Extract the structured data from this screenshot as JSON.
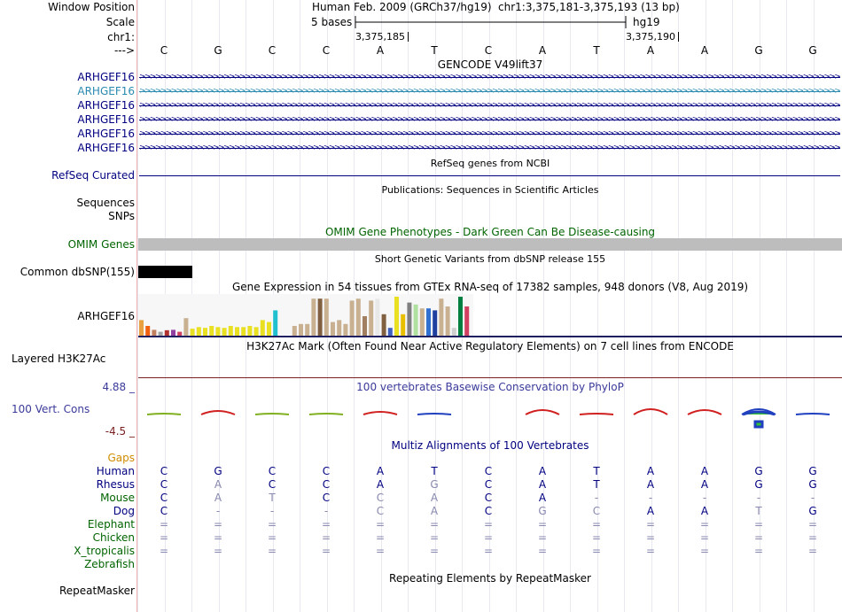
{
  "header": {
    "window_position_label": "Window Position",
    "scale_label": "Scale",
    "chr_label": "chr1:",
    "strand_label": "--->",
    "assembly": "Human Feb. 2009 (GRCh37/hg19)",
    "position": "chr1:3,375,181-3,375,193 (13 bp)",
    "scale_text": "5 bases",
    "db": "hg19",
    "coord1": "3,375,185",
    "coord2": "3,375,190"
  },
  "sequence": [
    "C",
    "G",
    "C",
    "C",
    "A",
    "T",
    "C",
    "A",
    "T",
    "A",
    "A",
    "G",
    "G"
  ],
  "gencode": {
    "title": "GENCODE V49lift37",
    "genes": [
      {
        "label": "ARHGEF16",
        "color": "#000080"
      },
      {
        "label": "ARHGEF16",
        "color": "#2a8ab0"
      },
      {
        "label": "ARHGEF16",
        "color": "#000080"
      },
      {
        "label": "ARHGEF16",
        "color": "#000080"
      },
      {
        "label": "ARHGEF16",
        "color": "#000080"
      },
      {
        "label": "ARHGEF16",
        "color": "#000080"
      }
    ]
  },
  "refseq": {
    "title": "RefSeq genes from NCBI",
    "label": "RefSeq Curated"
  },
  "publications": {
    "title": "Publications: Sequences in Scientific Articles",
    "label1": "Sequences",
    "label2": "SNPs"
  },
  "omim": {
    "title": "OMIM Gene Phenotypes - Dark Green Can Be Disease-causing",
    "label": "OMIM Genes"
  },
  "dbsnp": {
    "title": "Short Genetic Variants from dbSNP release 155",
    "label": "Common dbSNP(155)"
  },
  "gtex": {
    "title": "Gene Expression in 54 tissues from GTEx RNA-seq of 17382 samples, 948 donors (V8, Aug 2019)",
    "label": "ARHGEF16",
    "bars": [
      {
        "v": 0.4,
        "c": "#e8a040"
      },
      {
        "v": 0.25,
        "c": "#f06010"
      },
      {
        "v": 0.15,
        "c": "#c08060"
      },
      {
        "v": 0.1,
        "c": "#a0a0a0"
      },
      {
        "v": 0.14,
        "c": "#b03030"
      },
      {
        "v": 0.15,
        "c": "#9040a0"
      },
      {
        "v": 0.1,
        "c": "#d04060"
      },
      {
        "v": 0.45,
        "c": "#c8b090"
      },
      {
        "v": 0.18,
        "c": "#e8e020"
      },
      {
        "v": 0.22,
        "c": "#e8e020"
      },
      {
        "v": 0.2,
        "c": "#e8e020"
      },
      {
        "v": 0.25,
        "c": "#e8e020"
      },
      {
        "v": 0.22,
        "c": "#e8e020"
      },
      {
        "v": 0.2,
        "c": "#e8e020"
      },
      {
        "v": 0.25,
        "c": "#e8e020"
      },
      {
        "v": 0.22,
        "c": "#e8e020"
      },
      {
        "v": 0.22,
        "c": "#e8e020"
      },
      {
        "v": 0.25,
        "c": "#e8e020"
      },
      {
        "v": 0.22,
        "c": "#e8e020"
      },
      {
        "v": 0.4,
        "c": "#e8e020"
      },
      {
        "v": 0.35,
        "c": "#e8e020"
      },
      {
        "v": 0.65,
        "c": "#20c0d0"
      },
      {
        "v": 0.02,
        "c": "#ffffff"
      },
      {
        "v": 0.02,
        "c": "#ffffff"
      },
      {
        "v": 0.25,
        "c": "#c8b090"
      },
      {
        "v": 0.3,
        "c": "#c8b090"
      },
      {
        "v": 0.3,
        "c": "#c8b090"
      },
      {
        "v": 0.95,
        "c": "#c8b090"
      },
      {
        "v": 0.95,
        "c": "#806040"
      },
      {
        "v": 0.95,
        "c": "#c8b090"
      },
      {
        "v": 0.35,
        "c": "#c8b090"
      },
      {
        "v": 0.4,
        "c": "#c8b090"
      },
      {
        "v": 0.3,
        "c": "#c8b090"
      },
      {
        "v": 0.9,
        "c": "#c8b090"
      },
      {
        "v": 0.95,
        "c": "#c8b090"
      },
      {
        "v": 0.5,
        "c": "#a08060"
      },
      {
        "v": 0.9,
        "c": "#c8b090"
      },
      {
        "v": 0.95,
        "c": "#e8e8e8"
      },
      {
        "v": 0.55,
        "c": "#806040"
      },
      {
        "v": 0.2,
        "c": "#4060c0"
      },
      {
        "v": 1.0,
        "c": "#e8e020"
      },
      {
        "v": 0.55,
        "c": "#e8c000"
      },
      {
        "v": 0.85,
        "c": "#808080"
      },
      {
        "v": 0.8,
        "c": "#b0e0a0"
      },
      {
        "v": 0.7,
        "c": "#c8b090"
      },
      {
        "v": 0.7,
        "c": "#3070d0"
      },
      {
        "v": 0.65,
        "c": "#2040a0"
      },
      {
        "v": 0.95,
        "c": "#c8b090"
      },
      {
        "v": 0.75,
        "c": "#c8b090"
      },
      {
        "v": 0.2,
        "c": "#d0d0d0"
      },
      {
        "v": 1.0,
        "c": "#008040"
      },
      {
        "v": 0.75,
        "c": "#d04060"
      }
    ]
  },
  "h3k27ac": {
    "title": "H3K27Ac Mark (Often Found Near Active Regulatory Elements) on 7 cell lines from ENCODE",
    "label": "Layered H3K27Ac"
  },
  "phylop": {
    "title": "100 vertebrates Basewise Conservation by PhyloP",
    "label": "100 Vert. Cons",
    "max": "4.88 _",
    "min": "-4.5 _"
  },
  "multiz": {
    "title": "Multiz Alignments of 100 Vertebrates",
    "gaps_label": "Gaps",
    "species": [
      {
        "name": "Human",
        "color": "#000080",
        "bases": [
          "C",
          "G",
          "C",
          "C",
          "A",
          "T",
          "C",
          "A",
          "T",
          "A",
          "A",
          "G",
          "G"
        ],
        "gray": [
          0,
          0,
          0,
          0,
          0,
          0,
          0,
          0,
          0,
          0,
          0,
          0,
          0
        ]
      },
      {
        "name": "Rhesus",
        "color": "#000080",
        "bases": [
          "C",
          "A",
          "C",
          "C",
          "A",
          "G",
          "C",
          "A",
          "T",
          "A",
          "A",
          "G",
          "G"
        ],
        "gray": [
          0,
          1,
          0,
          0,
          0,
          1,
          0,
          0,
          0,
          0,
          0,
          0,
          0
        ]
      },
      {
        "name": "Mouse",
        "color": "#006400",
        "bases": [
          "C",
          "A",
          "T",
          "C",
          "C",
          "A",
          "C",
          "A",
          "-",
          "-",
          "-",
          "-",
          "-"
        ],
        "gray": [
          0,
          1,
          1,
          0,
          1,
          1,
          0,
          0,
          1,
          1,
          1,
          1,
          1
        ]
      },
      {
        "name": "Dog",
        "color": "#000080",
        "bases": [
          "C",
          "-",
          "-",
          "-",
          "C",
          "A",
          "C",
          "G",
          "C",
          "A",
          "A",
          "T",
          "G"
        ],
        "gray": [
          0,
          1,
          1,
          1,
          1,
          1,
          0,
          1,
          1,
          0,
          0,
          1,
          0
        ]
      },
      {
        "name": "Elephant",
        "color": "#006400",
        "bases": [
          "=",
          "=",
          "=",
          "=",
          "=",
          "=",
          "=",
          "=",
          "=",
          "=",
          "=",
          "=",
          "="
        ],
        "gray": [
          1,
          1,
          1,
          1,
          1,
          1,
          1,
          1,
          1,
          1,
          1,
          1,
          1
        ]
      },
      {
        "name": "Chicken",
        "color": "#006400",
        "bases": [
          "=",
          "=",
          "=",
          "=",
          "=",
          "=",
          "=",
          "=",
          "=",
          "=",
          "=",
          "=",
          "="
        ],
        "gray": [
          1,
          1,
          1,
          1,
          1,
          1,
          1,
          1,
          1,
          1,
          1,
          1,
          1
        ]
      },
      {
        "name": "X_tropicalis",
        "color": "#006400",
        "bases": [
          "=",
          "=",
          "=",
          "=",
          "=",
          "=",
          "=",
          "=",
          "=",
          "=",
          "=",
          "=",
          "="
        ],
        "gray": [
          1,
          1,
          1,
          1,
          1,
          1,
          1,
          1,
          1,
          1,
          1,
          1,
          1
        ]
      },
      {
        "name": "Zebrafish",
        "color": "#006400",
        "bases": [
          "",
          "",
          "",
          "",
          "",
          "",
          "",
          "",
          "",
          "",
          "",
          "",
          ""
        ],
        "gray": [
          1,
          1,
          1,
          1,
          1,
          1,
          1,
          1,
          1,
          1,
          1,
          1,
          1
        ]
      }
    ]
  },
  "repeatmasker": {
    "title": "Repeating Elements by RepeatMasker",
    "label": "RepeatMasker"
  }
}
